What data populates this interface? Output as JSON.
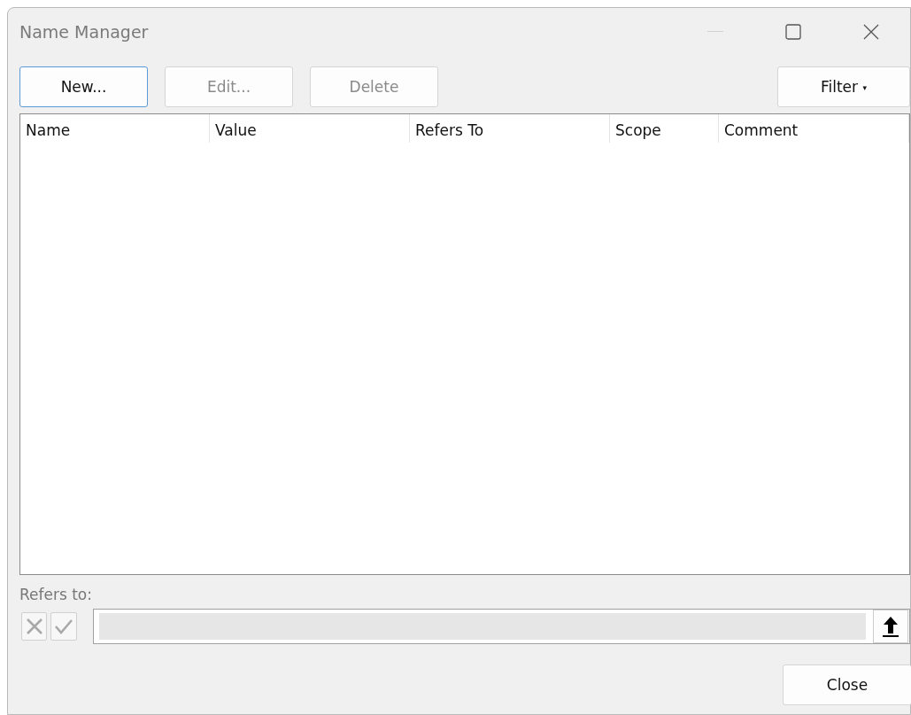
{
  "window": {
    "title": "Name Manager",
    "controls": [
      {
        "kind": "minimize",
        "disabled": true
      },
      {
        "kind": "maximize",
        "disabled": false
      },
      {
        "kind": "close",
        "disabled": false
      }
    ]
  },
  "toolbar": [
    {
      "label": "New...",
      "focused": true,
      "disabled": false
    },
    {
      "label": "Edit...",
      "focused": false,
      "disabled": true
    },
    {
      "label": "Delete",
      "focused": false,
      "disabled": true
    }
  ],
  "filter_button": {
    "label": "Filter",
    "caret": "▾"
  },
  "table": {
    "columns": [
      "Name",
      "Value",
      "Refers To",
      "Scope",
      "Comment"
    ]
  },
  "refers_to": {
    "label": "Refers to:",
    "cancel_disabled": true,
    "confirm_disabled": true,
    "disabled": true
  },
  "close_button": {
    "label": "Close"
  }
}
